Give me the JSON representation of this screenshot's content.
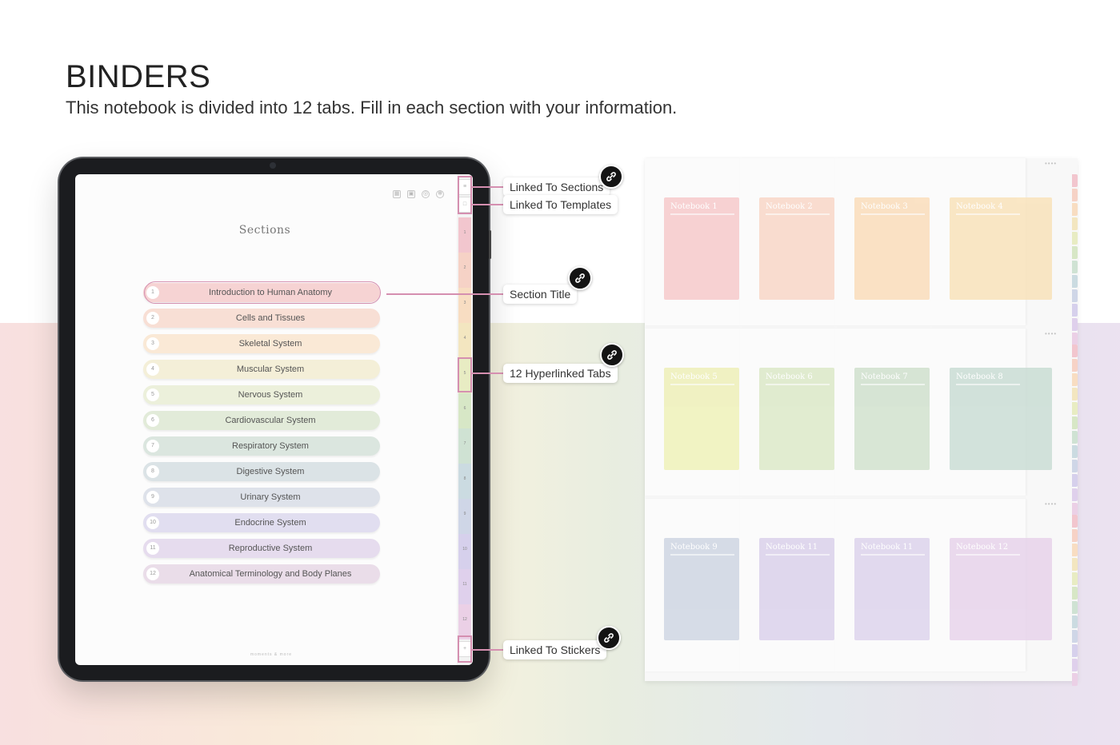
{
  "header": {
    "title": "BINDERS",
    "subtitle": "This notebook is divided into 12 tabs. Fill in each section with your information."
  },
  "tablet": {
    "sections_title": "Sections",
    "sections": [
      {
        "num": "1",
        "label": "Introduction to Human Anatomy",
        "color": "#f6d3d3"
      },
      {
        "num": "2",
        "label": "Cells and Tissues",
        "color": "#f8dfd5"
      },
      {
        "num": "3",
        "label": "Skeletal System",
        "color": "#fae9d6"
      },
      {
        "num": "4",
        "label": "Muscular System",
        "color": "#f4efd8"
      },
      {
        "num": "5",
        "label": "Nervous System",
        "color": "#ecf0db"
      },
      {
        "num": "6",
        "label": "Cardiovascular System",
        "color": "#e2ebd9"
      },
      {
        "num": "7",
        "label": "Respiratory System",
        "color": "#dbe6df"
      },
      {
        "num": "8",
        "label": "Digestive System",
        "color": "#dbe3e6"
      },
      {
        "num": "9",
        "label": "Urinary System",
        "color": "#dee2ea"
      },
      {
        "num": "10",
        "label": "Endocrine System",
        "color": "#e1def0"
      },
      {
        "num": "11",
        "label": "Reproductive System",
        "color": "#e6dcee"
      },
      {
        "num": "12",
        "label": "Anatomical Terminology and Body Planes",
        "color": "#eadde9"
      }
    ],
    "brand": "moments & more",
    "top_icons": [
      "calendar-icon",
      "briefcase-icon",
      "globe-icon",
      "settings-icon"
    ],
    "tab_numbers": [
      "1",
      "2",
      "3",
      "4",
      "5",
      "6",
      "7",
      "8",
      "9",
      "10",
      "11",
      "12"
    ],
    "tab_colors": [
      "#f2c6ce",
      "#f6d2c6",
      "#f8ddc2",
      "#f3e6c0",
      "#e8ecc3",
      "#d7e7c6",
      "#cfe2d3",
      "#cbdbe1",
      "#cfd6e7",
      "#d6d0ec",
      "#dfd0ec",
      "#ebd0e6"
    ]
  },
  "callouts": {
    "sections": "Linked To Sections",
    "templates": "Linked To Templates",
    "section_title": "Section Title",
    "tabs": "12 Hyperlinked Tabs",
    "stickers": "Linked To Stickers"
  },
  "preview": {
    "notebooks": [
      {
        "label": "Notebook 1",
        "color": "#f7c9ca"
      },
      {
        "label": "Notebook 2",
        "color": "#f9d6c6"
      },
      {
        "label": "Notebook 3",
        "color": "#fadcb8"
      },
      {
        "label": "Notebook 4",
        "color": "#f9e2b8"
      },
      {
        "label": "Notebook 5",
        "color": "#eef0b6"
      },
      {
        "label": "Notebook 6",
        "color": "#dbe8c6"
      },
      {
        "label": "Notebook 7",
        "color": "#cfe0cc"
      },
      {
        "label": "Notebook 8",
        "color": "#c8dcd3"
      },
      {
        "label": "Notebook 9",
        "color": "#cdd4e2"
      },
      {
        "label": "Notebook 11",
        "color": "#d9d0ea"
      },
      {
        "label": "Notebook 11",
        "color": "#dcd2ec"
      },
      {
        "label": "Notebook 12",
        "color": "#e7d2ea"
      }
    ],
    "dots": "••••"
  }
}
